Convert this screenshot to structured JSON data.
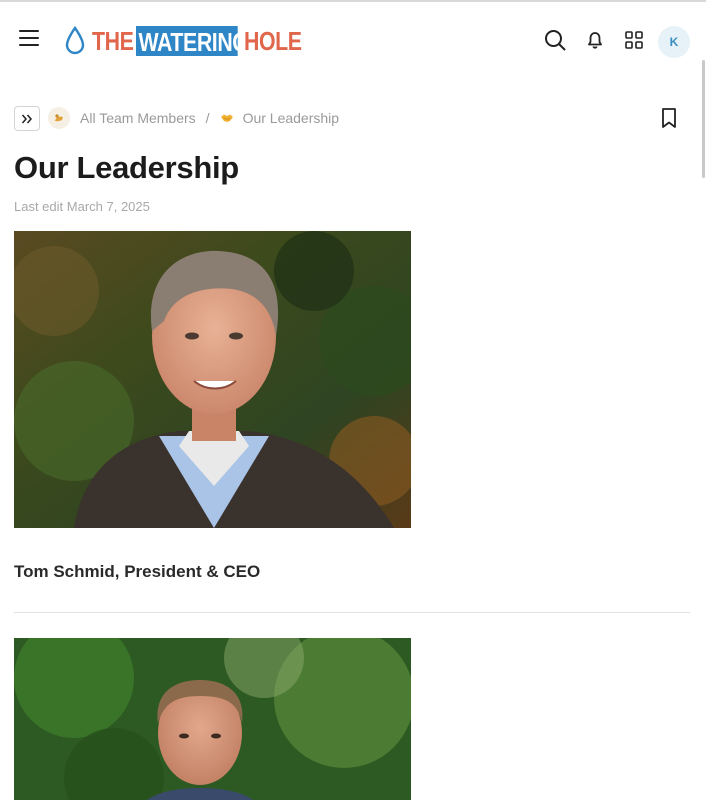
{
  "header": {
    "logo_parts": [
      "THE",
      "WATERING",
      "HOLE"
    ],
    "avatar_initial": "K",
    "icons": [
      "menu-icon",
      "search-icon",
      "bell-icon",
      "apps-grid-icon"
    ]
  },
  "breadcrumb": {
    "items": [
      {
        "label": "All Team Members",
        "icon": "team-badge-icon"
      },
      {
        "label": "Our Leadership",
        "icon": "handshake-icon"
      }
    ],
    "separator": "/"
  },
  "page": {
    "title": "Our Leadership",
    "last_edit": "Last edit March 7, 2025"
  },
  "members": [
    {
      "caption": "Tom Schmid, President & CEO"
    }
  ],
  "colors": {
    "logo_orange": "#e0664c",
    "logo_blue": "#2f86c6",
    "avatar_bg": "#e6f2f8"
  }
}
